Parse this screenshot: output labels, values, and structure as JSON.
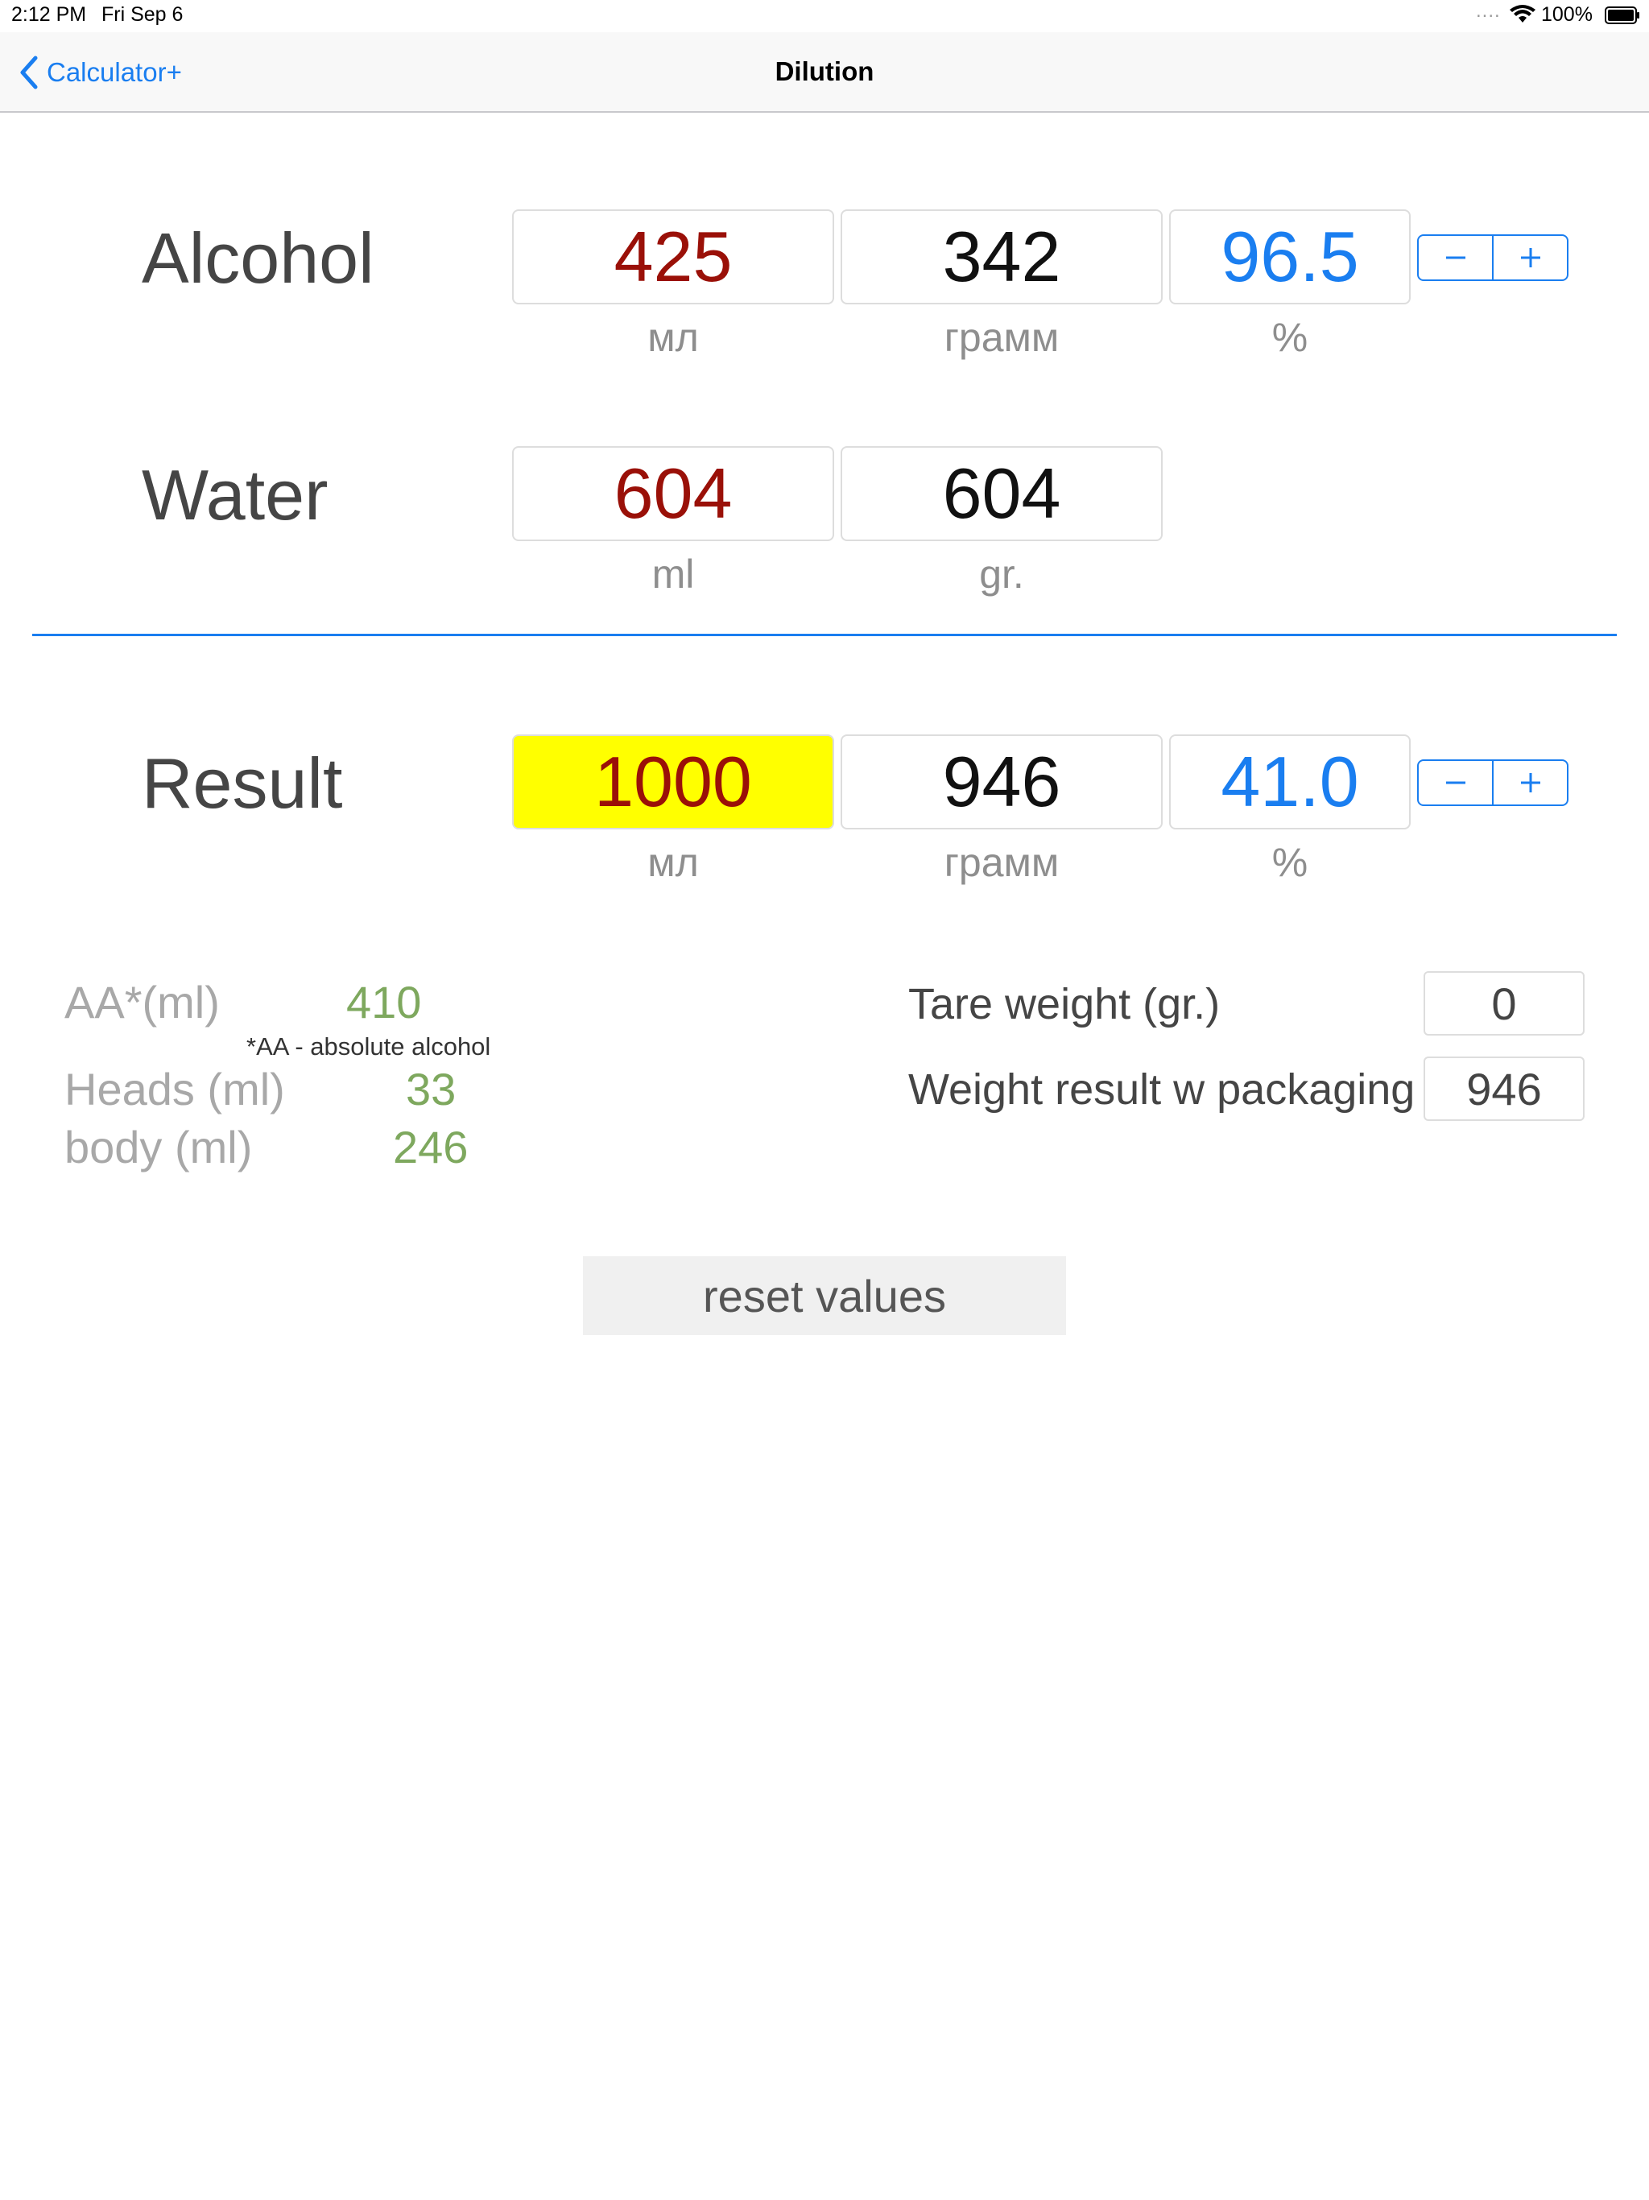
{
  "status_bar": {
    "time": "2:12 PM",
    "date": "Fri Sep 6",
    "battery": "100%"
  },
  "nav": {
    "back_label": "Calculator+",
    "title": "Dilution"
  },
  "alcohol": {
    "label": "Alcohol",
    "ml": "425",
    "gram": "342",
    "percent": "96.5",
    "unit_ml": "мл",
    "unit_gram": "грамм",
    "unit_percent": "%"
  },
  "water": {
    "label": "Water",
    "ml": "604",
    "gram": "604",
    "unit_ml": "ml",
    "unit_gram": "gr."
  },
  "result": {
    "label": "Result",
    "ml": "1000",
    "gram": "946",
    "percent": "41.0",
    "unit_ml": "мл",
    "unit_gram": "грамм",
    "unit_percent": "%"
  },
  "info": {
    "aa_label": "AA*(ml)",
    "aa_value": "410",
    "aa_note": "*AA - absolute alcohol",
    "heads_label": "Heads (ml)",
    "heads_value": "33",
    "body_label": "body (ml)",
    "body_value": "246",
    "tare_label": "Tare weight (gr.)",
    "tare_value": "0",
    "weight_label": "Weight result w packaging",
    "weight_value": "946"
  },
  "reset_label": "reset values",
  "colors": {
    "accent": "#1a7ef0",
    "red_value": "#9a1008",
    "green_value": "#7ea85e",
    "highlight": "#ffff00"
  }
}
